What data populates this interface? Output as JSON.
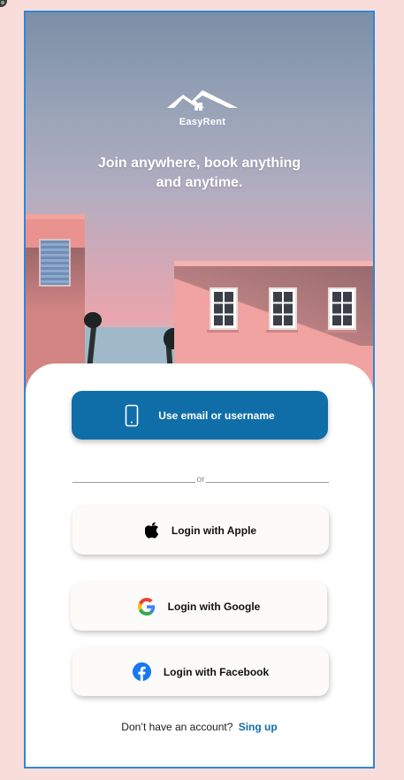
{
  "app": {
    "name": "EasyRent"
  },
  "hero": {
    "tagline_line1": "Join anywhere, book anything",
    "tagline_line2": "and anytime."
  },
  "auth": {
    "primary_button": "Use email or username",
    "divider_text": "or",
    "apple_button": "Login with Apple",
    "google_button": "Login with Google",
    "facebook_button": "Login with Facebook"
  },
  "signup": {
    "prompt": "Don’t have an account?",
    "link": "Sing up"
  },
  "icons": {
    "primary": "phone-icon",
    "apple": "apple-icon",
    "google": "google-icon",
    "facebook": "facebook-icon",
    "logo": "house-roof-logo"
  },
  "colors": {
    "primary": "#0f6ea8",
    "background": "#f9dddb",
    "frame_border": "#2f86d6",
    "facebook": "#1877f2"
  }
}
